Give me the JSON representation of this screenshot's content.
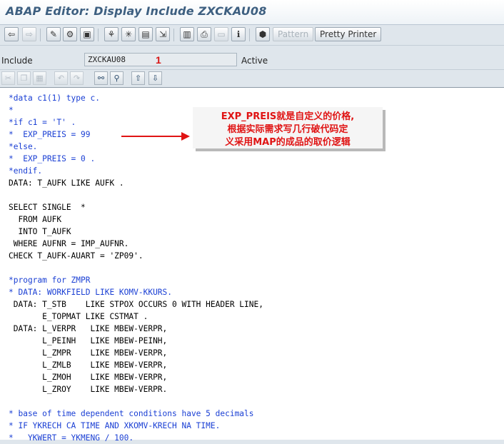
{
  "window": {
    "title": "ABAP Editor: Display Include ZXCKAU08"
  },
  "toolbar": {
    "buttons": [
      {
        "name": "back-button",
        "icon": "arrow-left-icon",
        "glyph": "⇦",
        "disabled": false
      },
      {
        "name": "forward-button",
        "icon": "arrow-right-icon",
        "glyph": "⇨",
        "disabled": true
      },
      {
        "name": "display-change-button",
        "icon": "pencil-glasses-icon",
        "glyph": "✎",
        "disabled": false
      },
      {
        "name": "other-object-button",
        "icon": "object-icon",
        "glyph": "⚙",
        "disabled": false
      },
      {
        "name": "check-button",
        "icon": "check-icon",
        "glyph": "▣",
        "disabled": false
      },
      {
        "name": "activate-button",
        "icon": "activate-icon",
        "glyph": "⚘",
        "disabled": false
      },
      {
        "name": "where-used-button",
        "icon": "where-used-icon",
        "glyph": "✳",
        "disabled": false
      },
      {
        "name": "display-object-list-button",
        "icon": "object-list-icon",
        "glyph": "▤",
        "disabled": false
      },
      {
        "name": "navigation-window-button",
        "icon": "navigation-icon",
        "glyph": "⇲",
        "disabled": false
      },
      {
        "name": "hierarchy-button",
        "icon": "hierarchy-icon",
        "glyph": "▥",
        "disabled": false
      },
      {
        "name": "print-button",
        "icon": "printer-icon",
        "glyph": "⎙",
        "disabled": false
      },
      {
        "name": "fullscreen-button",
        "icon": "fullscreen-icon",
        "glyph": "▭",
        "disabled": true
      },
      {
        "name": "info-button",
        "icon": "info-icon",
        "glyph": "ℹ",
        "disabled": false
      },
      {
        "name": "stop-button",
        "icon": "stop-icon",
        "glyph": "⬢",
        "disabled": false
      }
    ],
    "pattern_label": "Pattern",
    "pretty_printer_label": "Pretty Printer"
  },
  "include_row": {
    "include_label": "Include",
    "include_value": "ZXCKAU08",
    "status_label": "Active",
    "marker_number": "1"
  },
  "editor_toolbar": {
    "buttons": [
      {
        "name": "cut-button",
        "icon": "scissors-icon",
        "glyph": "✂",
        "disabled": true
      },
      {
        "name": "copy-button",
        "icon": "copy-icon",
        "glyph": "❐",
        "disabled": true
      },
      {
        "name": "paste-button",
        "icon": "paste-icon",
        "glyph": "▦",
        "disabled": true
      },
      {
        "name": "undo-button",
        "icon": "undo-icon",
        "glyph": "↶",
        "disabled": true
      },
      {
        "name": "redo-button",
        "icon": "redo-icon",
        "glyph": "↷",
        "disabled": true
      },
      {
        "name": "find-button",
        "icon": "binoculars-icon",
        "glyph": "⚯",
        "disabled": false
      },
      {
        "name": "find-next-button",
        "icon": "binoculars-next-icon",
        "glyph": "⚲",
        "disabled": false
      },
      {
        "name": "upload-button",
        "icon": "upload-icon",
        "glyph": "⇧",
        "disabled": false
      },
      {
        "name": "download-button",
        "icon": "download-icon",
        "glyph": "⇩",
        "disabled": false
      }
    ]
  },
  "code_lines": [
    {
      "text": "*data c1(1) type c.",
      "comment": true
    },
    {
      "text": "*",
      "comment": true
    },
    {
      "text": "*if c1 = 'T' .",
      "comment": true
    },
    {
      "text": "*  EXP_PREIS = 99",
      "comment": true
    },
    {
      "text": "*else.",
      "comment": true
    },
    {
      "text": "*  EXP_PREIS = 0 .",
      "comment": true
    },
    {
      "text": "*endif.",
      "comment": true
    },
    {
      "text": "DATA: T_AUFK LIKE AUFK .",
      "comment": false
    },
    {
      "text": "",
      "comment": false
    },
    {
      "text": "SELECT SINGLE  *",
      "comment": false
    },
    {
      "text": "  FROM AUFK",
      "comment": false
    },
    {
      "text": "  INTO T_AUFK",
      "comment": false
    },
    {
      "text": " WHERE AUFNR = IMP_AUFNR.",
      "comment": false
    },
    {
      "text": "CHECK T_AUFK-AUART = 'ZP09'.",
      "comment": false
    },
    {
      "text": "",
      "comment": false
    },
    {
      "text": "*program for ZMPR",
      "comment": true
    },
    {
      "text": "* DATA: WORKFIELD LIKE KOMV-KKURS.",
      "comment": true
    },
    {
      "text": " DATA: T_STB    LIKE STPOX OCCURS 0 WITH HEADER LINE,",
      "comment": false
    },
    {
      "text": "       E_TOPMAT LIKE CSTMAT .",
      "comment": false
    },
    {
      "text": " DATA: L_VERPR   LIKE MBEW-VERPR,",
      "comment": false
    },
    {
      "text": "       L_PEINH   LIKE MBEW-PEINH,",
      "comment": false
    },
    {
      "text": "       L_ZMPR    LIKE MBEW-VERPR,",
      "comment": false
    },
    {
      "text": "       L_ZMLB    LIKE MBEW-VERPR,",
      "comment": false
    },
    {
      "text": "       L_ZMOH    LIKE MBEW-VERPR,",
      "comment": false
    },
    {
      "text": "       L_ZROY    LIKE MBEW-VERPR.",
      "comment": false
    },
    {
      "text": "",
      "comment": false
    },
    {
      "text": "* base of time dependent conditions have 5 decimals",
      "comment": true
    },
    {
      "text": "* IF YKRECH CA TIME AND XKOMV-KRECH NA TIME.",
      "comment": true
    },
    {
      "text": "*   YKWERT = YKMENG / 100.",
      "comment": true
    }
  ],
  "annotation": {
    "lines": [
      "EXP_PREIS就是自定义的价格,",
      "根据实际需求写几行破代码定",
      "义采用MAP的成品的取价逻辑"
    ],
    "color": "#e01414"
  }
}
